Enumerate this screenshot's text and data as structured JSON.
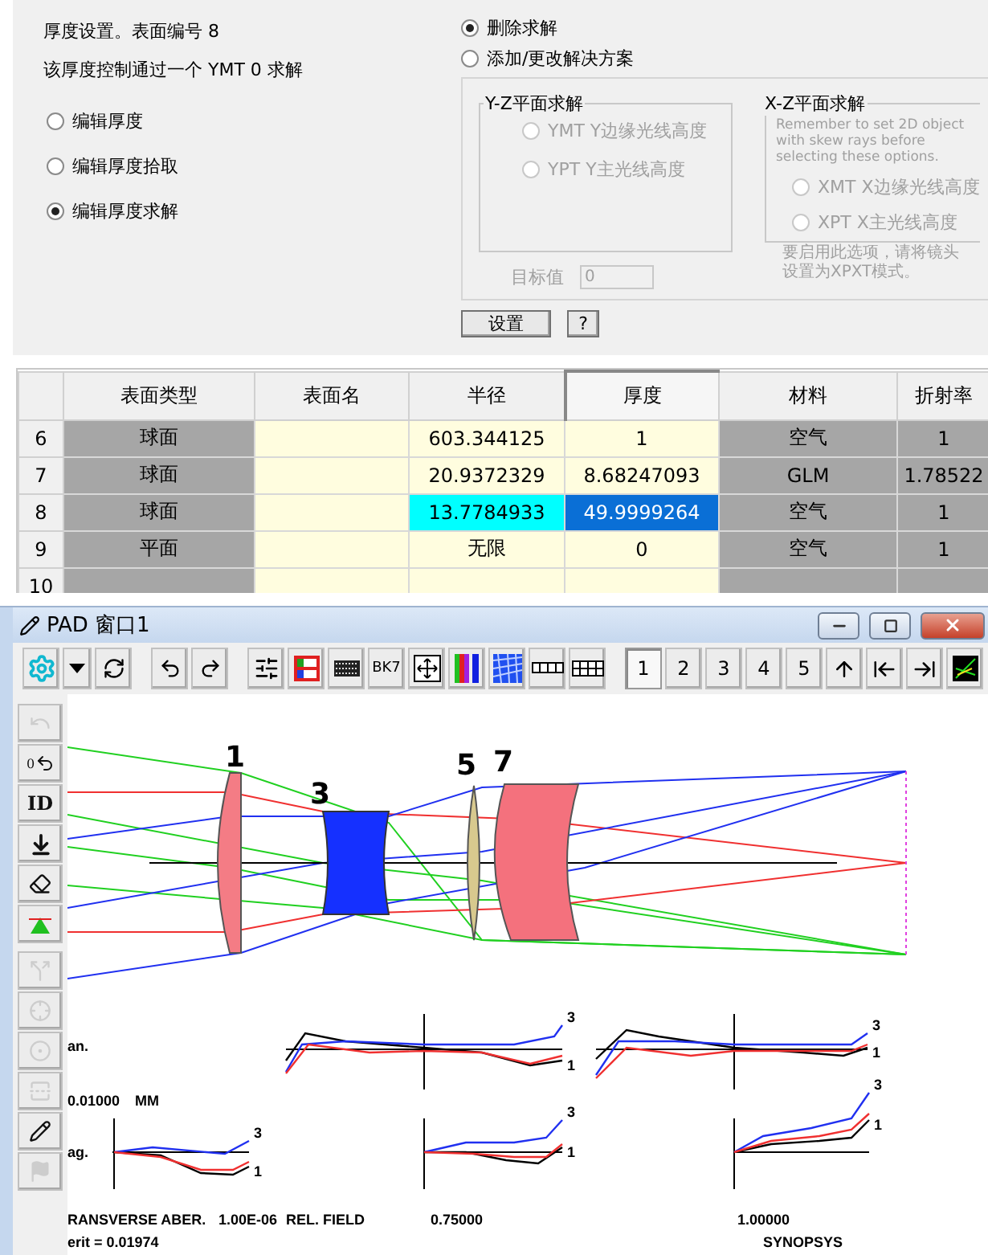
{
  "thickness_panel": {
    "title": "厚度设置。表面编号 8",
    "description": "该厚度控制通过一个 YMT 0 求解",
    "edit_modes": [
      {
        "label": "编辑厚度",
        "selected": false
      },
      {
        "label": "编辑厚度拾取",
        "selected": false
      },
      {
        "label": "编辑厚度求解",
        "selected": true
      }
    ],
    "solve_actions": [
      {
        "label": "删除求解",
        "selected": true
      },
      {
        "label": "添加/更改解决方案",
        "selected": false
      }
    ],
    "solve_options_disabled": true,
    "yz_group": {
      "title": "Y-Z平面求解",
      "options": [
        {
          "label": "YMT Y边缘光线高度",
          "selected": false
        },
        {
          "label": "YPT Y主光线高度",
          "selected": false
        }
      ]
    },
    "xz_group": {
      "title": "X-Z平面求解",
      "note": "Remember to set 2D object with skew rays before selecting these options.",
      "options": [
        {
          "label": "XMT X边缘光线高度",
          "selected": false
        },
        {
          "label": "XPT X主光线高度",
          "selected": false
        }
      ],
      "hint": "要启用此选项，请将镜头设置为XPXT模式。"
    },
    "target_label": "目标值",
    "target_value": "0",
    "buttons": [
      "设置",
      "?"
    ]
  },
  "table": {
    "columns": [
      {
        "label": "表面类型",
        "kind": "locked",
        "selected": false
      },
      {
        "label": "表面名",
        "kind": "editable",
        "selected": false
      },
      {
        "label": "半径",
        "kind": "editable",
        "selected": false
      },
      {
        "label": "厚度",
        "kind": "editable",
        "selected": true
      },
      {
        "label": "材料",
        "kind": "locked",
        "selected": false
      },
      {
        "label": "折射率",
        "kind": "locked",
        "selected": false
      }
    ],
    "rows": [
      {
        "number": "6",
        "cells": [
          "球面",
          null,
          "603.344125",
          "1",
          "空气",
          "1"
        ],
        "radius_highlighted": false,
        "thickness_selected": false
      },
      {
        "number": "7",
        "cells": [
          "球面",
          null,
          "20.9372329",
          "8.68247093",
          "GLM",
          "1.78522"
        ],
        "radius_highlighted": false,
        "thickness_selected": false
      },
      {
        "number": "8",
        "cells": [
          "球面",
          null,
          "13.7784933",
          "49.9999264",
          "空气",
          "1"
        ],
        "radius_highlighted": true,
        "thickness_selected": true
      },
      {
        "number": "9",
        "cells": [
          "平面",
          null,
          "无限",
          "0",
          "空气",
          "1"
        ],
        "radius_highlighted": false,
        "thickness_selected": false
      },
      {
        "number": "10",
        "cells": [
          null,
          null,
          null,
          null,
          null,
          null
        ],
        "radius_highlighted": false,
        "thickness_selected": false
      }
    ]
  },
  "pad_window": {
    "title": "PAD 窗口1",
    "toolbar": [
      {
        "kind": "gear"
      },
      {
        "kind": "dropdown"
      },
      {
        "kind": "refresh"
      },
      {
        "kind": "sep"
      },
      {
        "kind": "undo"
      },
      {
        "kind": "redo"
      },
      {
        "kind": "sep"
      },
      {
        "kind": "sliders"
      },
      {
        "kind": "layout"
      },
      {
        "kind": "film"
      },
      {
        "kind": "glass",
        "label": "BK7"
      },
      {
        "kind": "fit"
      },
      {
        "kind": "colorbars"
      },
      {
        "kind": "pattern"
      },
      {
        "kind": "grid-small"
      },
      {
        "kind": "grid-large"
      },
      {
        "kind": "sep"
      },
      {
        "kind": "number",
        "label": "1",
        "selected": true
      },
      {
        "kind": "number",
        "label": "2",
        "selected": false
      },
      {
        "kind": "number",
        "label": "3",
        "selected": false
      },
      {
        "kind": "number",
        "label": "4",
        "selected": false
      },
      {
        "kind": "number",
        "label": "5",
        "selected": false
      },
      {
        "kind": "up"
      },
      {
        "kind": "first"
      },
      {
        "kind": "last"
      },
      {
        "kind": "plot"
      }
    ],
    "left_tools": [
      {
        "kind": "undo",
        "disabled": true
      },
      {
        "kind": "reset",
        "label": "0",
        "disabled": false
      },
      {
        "kind": "text",
        "label": "ID",
        "disabled": false
      },
      {
        "kind": "insert",
        "disabled": false
      },
      {
        "kind": "eraser",
        "disabled": false
      },
      {
        "kind": "target",
        "disabled": false
      },
      {
        "kind": "split",
        "disabled": true
      },
      {
        "kind": "cross",
        "disabled": true
      },
      {
        "kind": "lens",
        "disabled": true
      },
      {
        "kind": "mirror",
        "disabled": true
      },
      {
        "kind": "pointer",
        "disabled": false
      },
      {
        "kind": "flag",
        "disabled": true
      }
    ],
    "surface_labels": [
      "1",
      "3",
      "5",
      "7"
    ],
    "plots": [
      {
        "curve_labels": [
          "3",
          "1"
        ]
      },
      {
        "curve_labels": [
          "3",
          "1"
        ]
      },
      {
        "curve_labels": [
          "3",
          "1"
        ]
      },
      {
        "curve_labels": [
          "3",
          "1"
        ]
      },
      {
        "curve_labels": [
          "3",
          "1"
        ]
      }
    ],
    "canvas_labels": {
      "tan": "an.",
      "scale": "0.01000",
      "unit": "MM",
      "sag": "ag.",
      "footer_title": "RANSVERSE ABER.",
      "footer_value": "1.00E-06",
      "field_label": "REL. FIELD",
      "field_1": "0.75000",
      "field_2": "1.00000",
      "merit": "erit = 0.01974",
      "brand": "SYNOPSYS"
    }
  }
}
